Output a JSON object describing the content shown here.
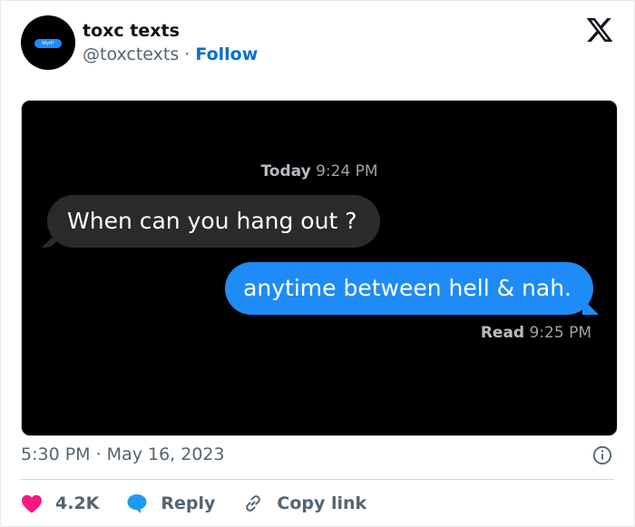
{
  "tweet": {
    "author": {
      "display_name": "toxc texts",
      "handle": "@toxctexts",
      "separator": "·",
      "follow_label": "Follow",
      "avatar_text": "Wyd?"
    },
    "media": {
      "chat_timestamp_day": "Today",
      "chat_timestamp_time": "9:24 PM",
      "incoming_message": "When can you hang out ?",
      "outgoing_message": "anytime between hell & nah.",
      "read_label": "Read",
      "read_time": "9:25 PM"
    },
    "timestamp": "5:30 PM · May 16, 2023",
    "actions": {
      "likes": "4.2K",
      "reply_label": "Reply",
      "copy_link_label": "Copy link"
    }
  },
  "colors": {
    "follow": "#0a6ed1",
    "heart": "#f91880",
    "reply_bubble": "#1d9bf0",
    "imessage_blue": "#1e8bf7",
    "imessage_gray": "#2a2a2c"
  }
}
